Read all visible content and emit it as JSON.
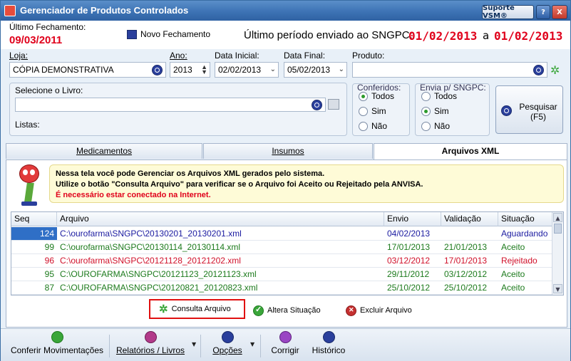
{
  "window": {
    "title": "Gerenciador de Produtos Controlados",
    "support_label": "Suporte VSM®",
    "help_label": "?",
    "close_label": "X"
  },
  "header": {
    "last_closing_label": "Último Fechamento:",
    "last_closing_date": "09/03/2011",
    "new_closing_label": "Novo Fechamento",
    "last_period_label": "Último período enviado ao SNGPC:",
    "period_start": "01/02/2013",
    "period_sep": "a",
    "period_end": "01/02/2013"
  },
  "filters": {
    "loja_label": "Loja:",
    "loja_value": "CÓPIA DEMONSTRATIVA",
    "ano_label": "Ano:",
    "ano_value": "2013",
    "data_inicial_label": "Data Inicial:",
    "data_inicial_value": "02/02/2013",
    "data_final_label": "Data Final:",
    "data_final_value": "05/02/2013",
    "produto_label": "Produto:",
    "produto_value": "",
    "livro_label": "Selecione o Livro:",
    "livro_value": "",
    "listas_label": "Listas:"
  },
  "conferidos": {
    "title": "Conferidos:",
    "options": [
      "Todos",
      "Sim",
      "Não"
    ],
    "selected": "Todos"
  },
  "envia": {
    "title": "Envia p/ SNGPC:",
    "options": [
      "Todos",
      "Sim",
      "Não"
    ],
    "selected": "Sim"
  },
  "search_button": {
    "line1": "Pesquisar",
    "line2": "(F5)"
  },
  "tabs": [
    "Medicamentos",
    "Insumos",
    "Arquivos XML"
  ],
  "active_tab": "Arquivos XML",
  "info": {
    "line1": "Nessa tela você pode Gerenciar os Arquivos XML gerados pelo sistema.",
    "line2": "Utilize o botão \"Consulta Arquivo\" para verificar se o Arquivo foi Aceito ou Rejeitado pela ANVISA.",
    "line3": "É necessário estar conectado na Internet."
  },
  "grid": {
    "columns": [
      "Seq",
      "Arquivo",
      "Envio",
      "Validação",
      "Situação"
    ],
    "rows": [
      {
        "seq": "124",
        "arquivo": "C:\\ourofarma\\SNGPC\\20130201_20130201.xml",
        "envio": "04/02/2013",
        "validacao": "",
        "situacao": "Aguardando",
        "color": "#1a1aa0",
        "selected": true
      },
      {
        "seq": "99",
        "arquivo": "C:\\ourofarma\\SNGPC\\20130114_20130114.xml",
        "envio": "17/01/2013",
        "validacao": "21/01/2013",
        "situacao": "Aceito",
        "color": "#1c7a1c",
        "selected": false
      },
      {
        "seq": "96",
        "arquivo": "C:\\ourofarma\\SNGPC\\20121128_20121202.xml",
        "envio": "03/12/2012",
        "validacao": "17/01/2013",
        "situacao": "Rejeitado",
        "color": "#d0102a",
        "selected": false
      },
      {
        "seq": "95",
        "arquivo": "C:\\OUROFARMA\\SNGPC\\20121123_20121123.xml",
        "envio": "29/11/2012",
        "validacao": "03/12/2012",
        "situacao": "Aceito",
        "color": "#1c7a1c",
        "selected": false
      },
      {
        "seq": "87",
        "arquivo": "C:\\OUROFARMA\\SNGPC\\20120821_20120823.xml",
        "envio": "25/10/2012",
        "validacao": "25/10/2012",
        "situacao": "Aceito",
        "color": "#1c7a1c",
        "selected": false
      }
    ]
  },
  "actions": {
    "consulta": "Consulta Arquivo",
    "altera": "Altera Situação",
    "excluir": "Excluir Arquivo"
  },
  "bottom": {
    "conferir": "Conferir Movimentações",
    "relatorios": "Relatórios / Livros",
    "opcoes": "Opções",
    "corrigir": "Corrigir",
    "historico": "Histórico"
  },
  "colors": {
    "accent": "#3d73b5",
    "alert_red": "#e0001b",
    "highlight_border": "#e01010",
    "selected_row": "#2f6fc6"
  }
}
